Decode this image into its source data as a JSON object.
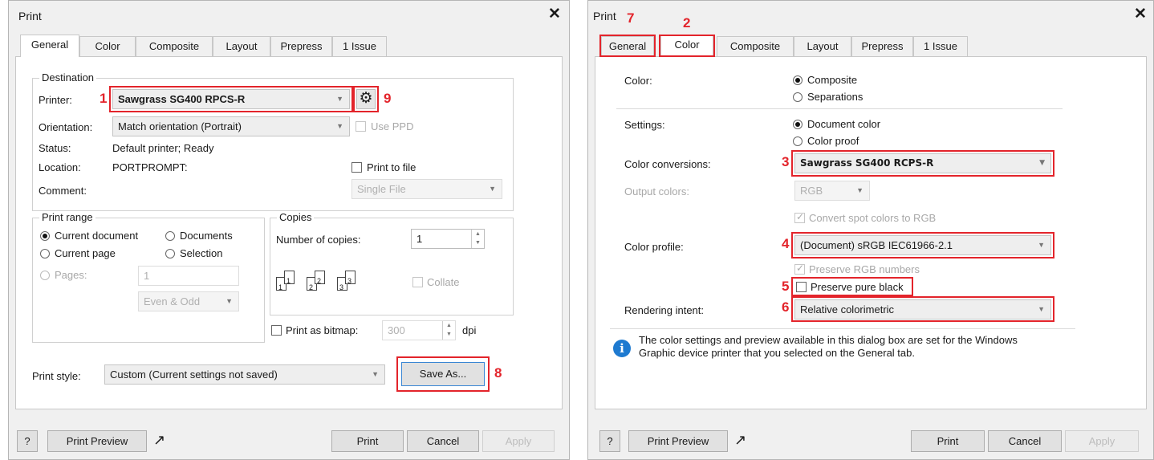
{
  "left": {
    "title": "Print",
    "tabs": [
      "General",
      "Color",
      "Composite",
      "Layout",
      "Prepress",
      "1 Issue"
    ],
    "destination": {
      "group": "Destination",
      "printer_label": "Printer:",
      "printer_value": "Sawgrass SG400 RPCS-R",
      "orientation_label": "Orientation:",
      "orientation_value": "Match orientation (Portrait)",
      "use_ppd": "Use PPD",
      "status_label": "Status:",
      "status_value": "Default printer; Ready",
      "location_label": "Location:",
      "location_value": "PORTPROMPT:",
      "print_to_file": "Print to file",
      "comment_label": "Comment:",
      "file_mode": "Single File"
    },
    "print_range": {
      "group": "Print range",
      "current_document": "Current document",
      "documents": "Documents",
      "current_page": "Current page",
      "selection": "Selection",
      "pages": "Pages:",
      "pages_value": "1",
      "page_filter": "Even & Odd"
    },
    "copies": {
      "group": "Copies",
      "number_label": "Number of copies:",
      "number_value": "1",
      "collate": "Collate",
      "collate_pages": [
        "1",
        "1",
        "2",
        "2",
        "3",
        "3"
      ]
    },
    "print_as_bitmap": "Print as bitmap:",
    "dpi_value": "300",
    "dpi_unit": "dpi",
    "print_style_label": "Print style:",
    "print_style_value": "Custom (Current settings not saved)",
    "save_as": "Save As...",
    "markers": {
      "printer": "1",
      "save_as": "8",
      "settings": "9"
    }
  },
  "right": {
    "title": "Print",
    "tabs": [
      "General",
      "Color",
      "Composite",
      "Layout",
      "Prepress",
      "1 Issue"
    ],
    "color_label": "Color:",
    "composite": "Composite",
    "separations": "Separations",
    "settings_label": "Settings:",
    "document_color": "Document color",
    "color_proof": "Color proof",
    "conversions_label": "Color conversions:",
    "conversions_value": "Sawgrass SG400 RCPS-R",
    "output_label": "Output colors:",
    "output_value": "RGB",
    "convert_spot": "Convert spot colors to RGB",
    "profile_label": "Color profile:",
    "profile_value": "(Document) sRGB IEC61966-2.1",
    "preserve_rgb": "Preserve RGB numbers",
    "preserve_black": "Preserve pure black",
    "intent_label": "Rendering intent:",
    "intent_value": "Relative colorimetric",
    "info_text": "The color settings and preview available in this dialog box are set for the Windows Graphic device printer that you selected on the General tab.",
    "markers": {
      "general": "7",
      "color": "2",
      "conversions": "3",
      "profile": "4",
      "black": "5",
      "intent": "6"
    }
  },
  "footer": {
    "help": "?",
    "preview": "Print Preview",
    "print": "Print",
    "cancel": "Cancel",
    "apply": "Apply"
  },
  "colors": {
    "highlight": "#e3242b",
    "info": "#1e7ad0"
  },
  "icons": [
    "close-icon",
    "gear-icon",
    "dropdown-arrow-icon",
    "popout-icon",
    "info-icon",
    "collate-pages-icon"
  ]
}
